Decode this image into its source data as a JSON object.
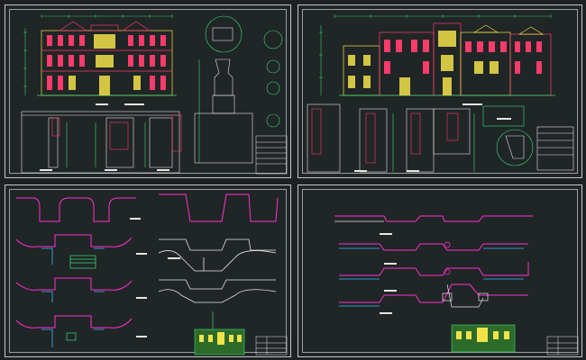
{
  "sheets": [
    {
      "id": "elevation-front"
    },
    {
      "id": "elevation-rear"
    },
    {
      "id": "plans-left"
    },
    {
      "id": "plans-right"
    }
  ],
  "colors": {
    "background": "#1d2122",
    "border": "#c8c8c8",
    "building_red": "#ff3b6b",
    "building_yellow": "#f2e24a",
    "building_green": "#39e07a",
    "dimension_green": "#2fd36b",
    "plan_magenta": "#ff2fd0",
    "plan_cyan": "#3ab7ff",
    "text_white": "#e6e6e6"
  },
  "icons": [
    "column-detail-icon",
    "ornament-detail-icon",
    "title-block-icon"
  ]
}
